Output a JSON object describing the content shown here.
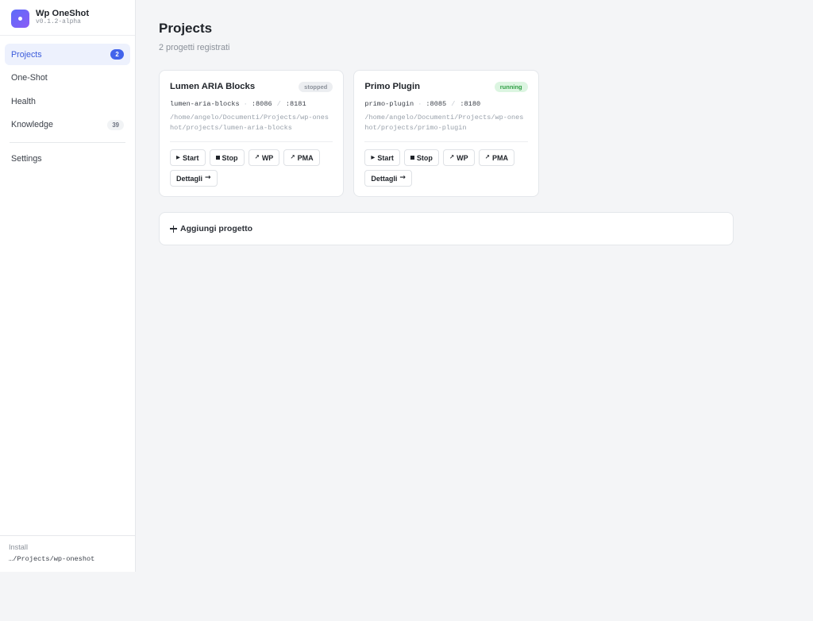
{
  "app": {
    "name": "Wp OneShot",
    "version": "v0.1.2-alpha"
  },
  "icons": {
    "logo": "logo-icon",
    "start": "play-icon",
    "stop": "stop-icon",
    "wp": "external-link-icon",
    "pma": "external-link-icon",
    "details": "arrow-right-icon",
    "add_project": "plus-icon"
  },
  "colors": {
    "accent": "#4263eb",
    "accent_text": "#3b5bdb",
    "accent_soft": "#edf1fd",
    "logo_from": "#5b6cf9",
    "logo_to": "#8b5cf6",
    "status_stopped_bg": "#eceef1",
    "status_stopped_fg": "#8c929b",
    "status_running_bg": "#dcf5e1",
    "status_running_fg": "#2f9e44"
  },
  "sidebar": {
    "nav": [
      {
        "label": "Projects",
        "badge": "2",
        "active": true
      },
      {
        "label": "One-Shot",
        "active": false
      },
      {
        "label": "Health",
        "active": false
      },
      {
        "label": "Knowledge",
        "badge": "39",
        "active": false
      }
    ],
    "settings": {
      "label": "Settings",
      "active": false
    },
    "footer": {
      "label": "Install",
      "path": "…/Projects/wp-oneshot"
    }
  },
  "main": {
    "title": "Projects",
    "subtitle": "2 progetti registrati",
    "separators": {
      "dot": "·",
      "slash": "/"
    },
    "actions": {
      "start": "Start",
      "stop": "Stop",
      "wp": "WP",
      "pma": "PMA",
      "details": "Dettagli"
    },
    "projects": [
      {
        "name": "Lumen ARIA Blocks",
        "status": "stopped",
        "slug": "lumen-aria-blocks",
        "wp_port": ":8086",
        "pma_port": ":8181",
        "path": "/home/angelo/Documenti/Projects/wp-oneshot/projects/lumen-aria-blocks"
      },
      {
        "name": "Primo Plugin",
        "status": "running",
        "slug": "primo-plugin",
        "wp_port": ":8085",
        "pma_port": ":8180",
        "path": "/home/angelo/Documenti/Projects/wp-oneshot/projects/primo-plugin"
      }
    ],
    "add_project": "Aggiungi progetto"
  }
}
